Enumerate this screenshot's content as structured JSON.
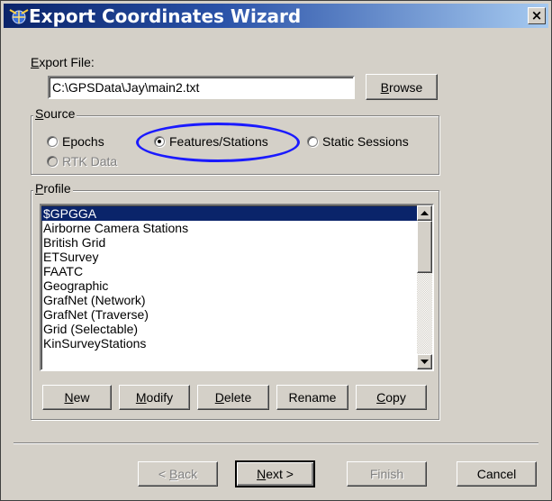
{
  "window": {
    "title": "Export Coordinates Wizard",
    "close_glyph": "×"
  },
  "export_file": {
    "label_prefix": "",
    "label_mnemonic": "E",
    "label_rest": "xport File:",
    "value": "C:\\GPSData\\Jay\\main2.txt",
    "browse_mnemonic": "B",
    "browse_rest": "rowse"
  },
  "source": {
    "title_mnemonic": "S",
    "title_rest": "ource",
    "options": {
      "epochs": "Epochs",
      "features": "Features/Stations",
      "static": "Static Sessions",
      "rtk": "RTK Data"
    },
    "selected": "features"
  },
  "profile": {
    "title_mnemonic": "P",
    "title_rest": "rofile",
    "items": [
      "$GPGGA",
      "Airborne Camera Stations",
      "British Grid",
      "ETSurvey",
      "FAATC",
      "Geographic",
      "GrafNet (Network)",
      "GrafNet (Traverse)",
      "Grid (Selectable)",
      "KinSurveyStations"
    ],
    "selected_index": 0,
    "buttons": {
      "new_m": "N",
      "new_r": "ew",
      "modify_m": "M",
      "modify_r": "odify",
      "delete_m": "D",
      "delete_r": "elete",
      "rename": "Rename",
      "copy_m": "C",
      "copy_r": "opy"
    }
  },
  "footer": {
    "back_prefix": "< ",
    "back_m": "B",
    "back_r": "ack",
    "next_m": "N",
    "next_r": "ext >",
    "finish": "Finish",
    "cancel": "Cancel"
  },
  "colors": {
    "selection": "#0a246a",
    "annotation_ellipse": "#1a1aff",
    "face": "#d4d0c8"
  },
  "icons": {
    "title": "satellite-globe-icon",
    "scroll_up": "up-arrow-icon",
    "scroll_down": "down-arrow-icon"
  }
}
